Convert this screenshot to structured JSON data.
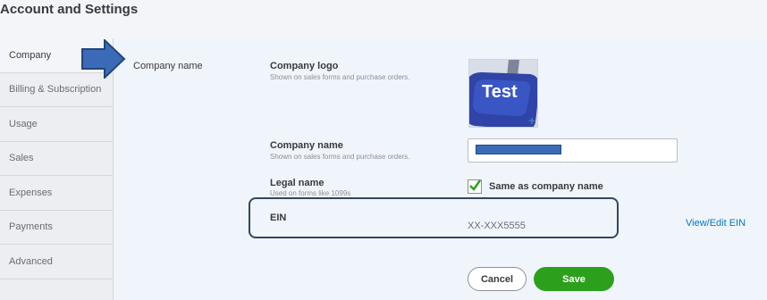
{
  "page": {
    "title": "Account and Settings"
  },
  "sidebar": {
    "items": [
      {
        "label": "Company",
        "active": true
      },
      {
        "label": "Billing & Subscription"
      },
      {
        "label": "Usage"
      },
      {
        "label": "Sales"
      },
      {
        "label": "Expenses"
      },
      {
        "label": "Payments"
      },
      {
        "label": "Advanced"
      }
    ]
  },
  "section": {
    "label": "Company name"
  },
  "fields": {
    "logo": {
      "label": "Company logo",
      "help": "Shown on sales forms and purchase orders.",
      "image_text": "Test"
    },
    "company_name": {
      "label": "Company name",
      "help": "Shown on sales forms and purchase orders.",
      "value": ""
    },
    "legal_name": {
      "label": "Legal name",
      "help": "Used on forms like 1099s",
      "checkbox_label": "Same as company name",
      "checked": true
    },
    "ein": {
      "label": "EIN",
      "value": "XX-XXX5555",
      "link": "View/Edit EIN"
    }
  },
  "actions": {
    "cancel": "Cancel",
    "save": "Save"
  },
  "colors": {
    "accent": "#2ca01c",
    "link": "#0077c5",
    "annotation": "#3b6bb7"
  },
  "icons": {
    "logo_add": "plus-icon",
    "checkbox": "checkmark-icon",
    "annotation": "arrow-right-icon"
  }
}
